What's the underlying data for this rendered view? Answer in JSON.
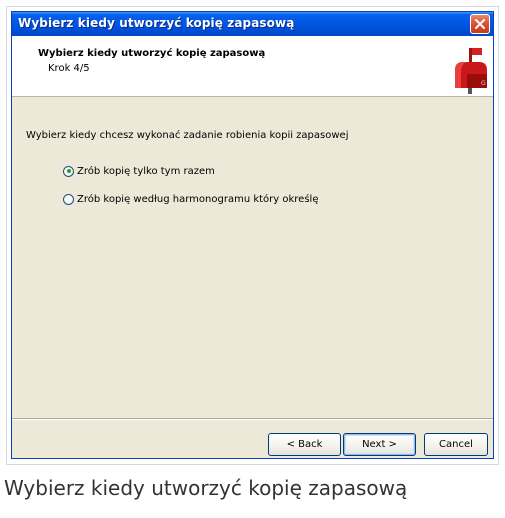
{
  "window": {
    "title": "Wybierz kiedy utworzyć kopię zapasową"
  },
  "header": {
    "title": "Wybierz kiedy utworzyć kopię zapasową",
    "step": "Krok 4/5",
    "icon": "mailbox-icon"
  },
  "main": {
    "instruction": "Wybierz kiedy chcesz wykonać zadanie robienia kopii zapasowej",
    "options": [
      {
        "label": "Zrób kopię tylko tym razem",
        "selected": true
      },
      {
        "label": "Zrób kopię według harmonogramu który określę",
        "selected": false
      }
    ]
  },
  "buttons": {
    "back": "< Back",
    "next": "Next >",
    "cancel": "Cancel"
  },
  "caption": "Wybierz kiedy utworzyć kopię zapasową",
  "colors": {
    "titlebar": "#0058e6",
    "dialog_bg": "#ece9d8",
    "close_button": "#d8512f",
    "radio_dot": "#21a121"
  }
}
